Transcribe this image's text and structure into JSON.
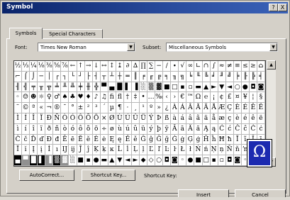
{
  "window": {
    "title": "Symbol"
  },
  "titlebar_buttons": [
    "?",
    "X"
  ],
  "tabs": [
    {
      "label": "Symbols"
    },
    {
      "label": "Special Characters"
    }
  ],
  "font_field": {
    "label": "Font:",
    "value": "Times New Roman"
  },
  "subset_field": {
    "label": "Subset:",
    "value": "Miscellaneous Symbols"
  },
  "symbols": [
    "½",
    "⅓",
    "¼",
    "⅛",
    "⅜",
    "⅝",
    "⅞",
    "←",
    "↑",
    "→",
    "↓",
    "↔",
    "↕",
    "↨",
    "∂",
    "∆",
    "∏",
    "∑",
    "−",
    "∕",
    "∙",
    "√",
    "∞",
    "∟",
    "∩",
    "∫",
    "≈",
    "≠",
    "≡",
    "≤",
    "≥",
    "⌂",
    "⌐",
    "⌠",
    "⌡",
    "─",
    "│",
    "┌",
    "┐",
    "└",
    "┘",
    "├",
    "┤",
    "┬",
    "┴",
    "┼",
    "═",
    "║",
    "╒",
    "╓",
    "╔",
    "╕",
    "╖",
    "╗",
    "╘",
    "╙",
    "╚",
    "╛",
    "╜",
    "╝",
    "╞",
    "╟",
    "╠",
    "╡",
    "╢",
    "╣",
    "╤",
    "╥",
    "╦",
    "╧",
    "╨",
    "╩",
    "╪",
    "╫",
    "╬",
    "▀",
    "▄",
    "█",
    "▌",
    "▐",
    "░",
    "▒",
    "▓",
    "■",
    "□",
    "▪",
    "▫",
    "▬",
    "▲",
    "►",
    "▼",
    "◄",
    "○",
    "●",
    "◘",
    "◙",
    "◦",
    "☺",
    "☻",
    "☼",
    "♀",
    "♂",
    "♠",
    "♣",
    "♥",
    "♦",
    "♪",
    "♫",
    "ﬁ",
    "ﬂ",
    "†",
    "‡",
    "•",
    "…",
    "‰",
    "‹",
    "›",
    "€",
    "™",
    "Ω",
    "℮",
    "¡",
    "¢",
    "£",
    "¤",
    "¥",
    "¦",
    "§",
    "¨",
    "©",
    "ª",
    "«",
    "¬",
    "®",
    "¯",
    "°",
    "±",
    "²",
    "³",
    "´",
    "µ",
    "¶",
    "·",
    "¸",
    "¹",
    "º",
    "»",
    "¿",
    "À",
    "Á",
    "Â",
    "Ã",
    "Ä",
    "Å",
    "Æ",
    "Ç",
    "È",
    "É",
    "Ê",
    "Ë",
    "Ì",
    "Í",
    "Î",
    "Ï",
    "Ð",
    "Ñ",
    "Ò",
    "Ó",
    "Ô",
    "Õ",
    "Ö",
    "×",
    "Ø",
    "Ù",
    "Ú",
    "Û",
    "Ü",
    "Ý",
    "Þ",
    "ß",
    "à",
    "á",
    "â",
    "ã",
    "ä",
    "å",
    "æ",
    "ç",
    "è",
    "é",
    "ê",
    "ë",
    "ì",
    "í",
    "î",
    "ï",
    "ð",
    "ñ",
    "ò",
    "ó",
    "ô",
    "õ",
    "ö",
    "÷",
    "ø",
    "ù",
    "ú",
    "û",
    "ü",
    "ý",
    "þ",
    "ÿ",
    "Ā",
    "ā",
    "Ă",
    "ă",
    "Ą",
    "ą",
    "Ć",
    "ć",
    "Ĉ",
    "ĉ",
    "Ċ",
    "ċ",
    "Č",
    "č",
    "Ď",
    "ď",
    "Đ",
    "đ",
    "Ē",
    "ē",
    "Ĕ",
    "ĕ",
    "Ė",
    "ė",
    "Ę",
    "ę",
    "Ě",
    "ě",
    "Ĝ",
    "ĝ",
    "Ğ",
    "ğ",
    "Ġ",
    "ġ",
    "Ģ",
    "ģ",
    "Ĥ",
    "ĥ",
    "Ħ",
    "ħ",
    "Ĩ",
    "ĩ",
    "Ī",
    "ī",
    "Ĭ",
    "ĭ",
    "Į",
    "į",
    "İ",
    "ı",
    "Ĳ",
    "ĳ",
    "Ĵ",
    "ĵ",
    "Ķ",
    "ķ",
    "ĸ",
    "Ĺ",
    "ĺ",
    "Ļ",
    "ļ",
    "Ľ",
    "ľ",
    "Ŀ",
    "ŀ",
    "Ł",
    "ł",
    "Ń",
    "ń",
    "Ņ",
    "ņ",
    "Ň",
    "ň",
    "ŉ",
    "Ŋ",
    "ŋ",
    "▄",
    "▀",
    "█",
    "▌",
    "▐",
    "▒",
    "▓",
    "░",
    "■",
    "▪",
    "●",
    "▬",
    "▲",
    "▼",
    "◄",
    "►",
    "◆",
    "◇",
    "○",
    "◘",
    "◙",
    "◦",
    "●",
    "■",
    "□",
    "▪",
    "▫",
    "◘",
    "◙",
    "◦",
    "○",
    "●"
  ],
  "buttons": {
    "auto_correct": "AutoCorrect...",
    "shortcut_key": "Shortcut Key...",
    "shortcut_key_label": "Shortcut Key:",
    "insert": "Insert",
    "cancel": "Cancel"
  }
}
